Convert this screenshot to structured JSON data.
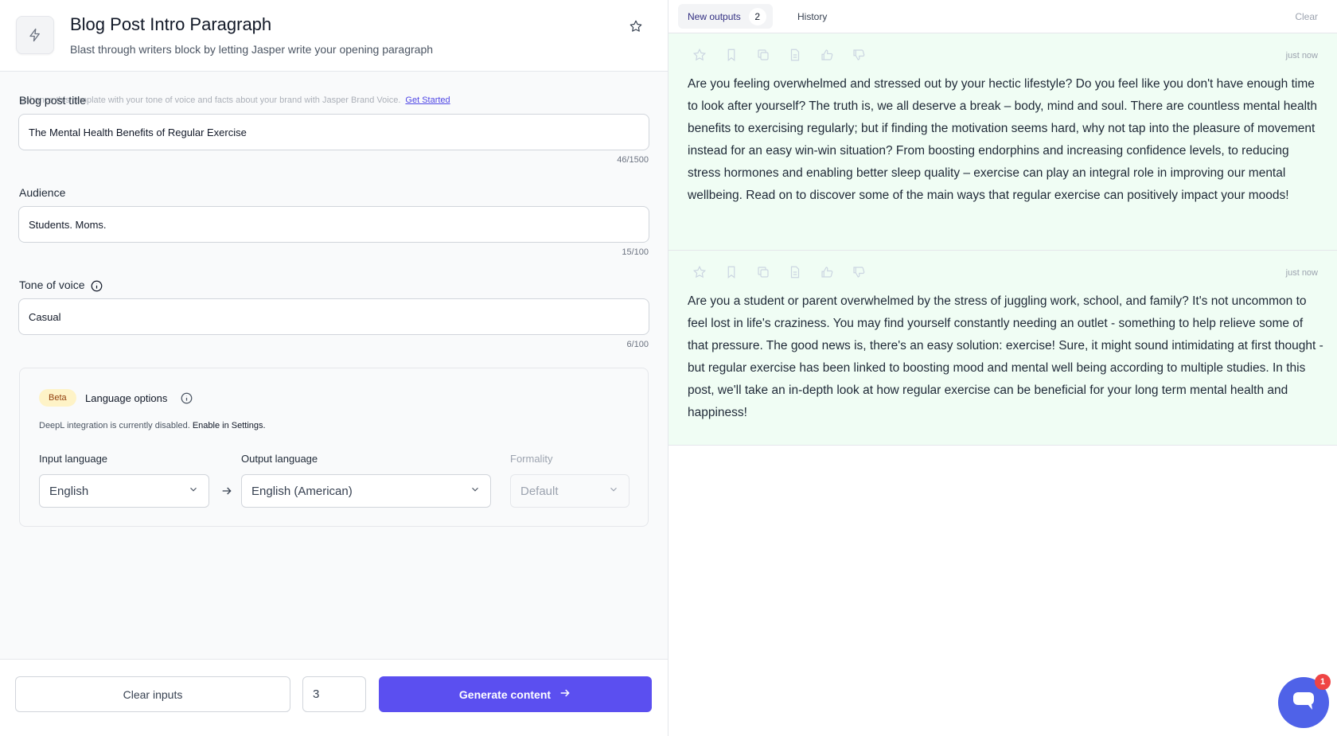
{
  "template": {
    "title": "Blog Post Intro Paragraph",
    "subtitle": "Blast through writers block by letting Jasper write your opening paragraph"
  },
  "brand_voice_note": {
    "text": "Enhance this template with your tone of voice and facts about your brand with Jasper Brand Voice.",
    "link": "Get Started"
  },
  "fields": {
    "title": {
      "label": "Blog post title",
      "value": "The Mental Health Benefits of Regular Exercise",
      "counter": "46/1500"
    },
    "audience": {
      "label": "Audience",
      "value": "Students. Moms.",
      "counter": "15/100"
    },
    "tone": {
      "label": "Tone of voice",
      "value": "Casual",
      "counter": "6/100"
    }
  },
  "language": {
    "badge": "Beta",
    "title": "Language options",
    "note": "DeepL integration is currently disabled.",
    "note_link": "Enable in Settings.",
    "input_label": "Input language",
    "input_value": "English",
    "output_label": "Output language",
    "output_value": "English (American)",
    "formality_label": "Formality",
    "formality_value": "Default"
  },
  "footer": {
    "clear_label": "Clear inputs",
    "count_value": "3",
    "generate_label": "Generate content"
  },
  "tabs": {
    "new_outputs": "New outputs",
    "new_count": "2",
    "history": "History",
    "clear": "Clear"
  },
  "outputs": [
    {
      "time": "just now",
      "text": "Are you feeling overwhelmed and stressed out by your hectic lifestyle? Do you feel like you don't have enough time to look after yourself? The truth is, we all deserve a break – body, mind and soul. There are countless mental health benefits to exercising regularly; but if finding the motivation seems hard, why not tap into the pleasure of movement instead for an easy win-win situation? From boosting endorphins and increasing confidence levels, to reducing stress hormones and enabling better sleep quality – exercise can play an integral role in improving our mental wellbeing. Read on to discover some of the main ways that regular exercise can positively impact your moods!"
    },
    {
      "time": "just now",
      "text": "Are you a student or parent overwhelmed by the stress of juggling work, school, and family? It's not uncommon to feel lost in life's craziness. You may find yourself constantly needing an outlet - something to help relieve some of that pressure. The good news is, there's an easy solution: exercise! Sure, it might sound intimidating at first thought - but regular exercise has been linked to boosting mood and mental well being according to multiple studies. In this post, we'll take an in-depth look at how regular exercise can be beneficial for your long term mental health and happiness!"
    }
  ],
  "chat": {
    "badge": "1"
  },
  "colors": {
    "primary": "#5b4ff0",
    "output_bg": "#f0fdf4",
    "beta_bg": "#fef3c7"
  }
}
